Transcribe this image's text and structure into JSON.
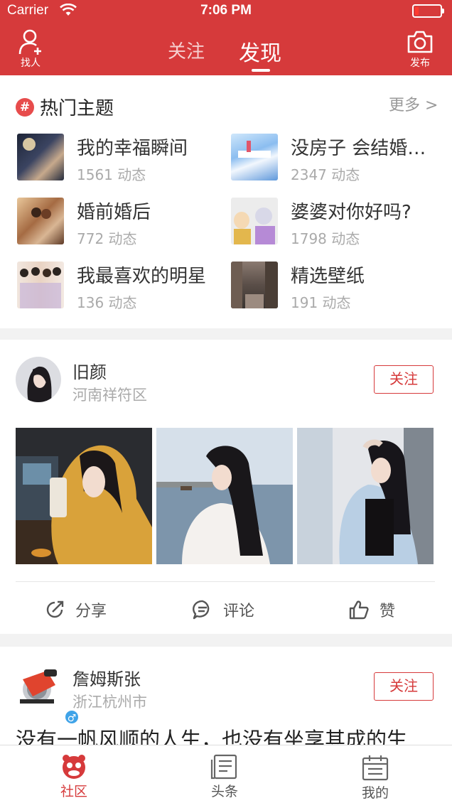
{
  "status_bar": {
    "carrier": "Carrier",
    "time": "7:06 PM"
  },
  "header": {
    "find_people": "找人",
    "publish": "发布",
    "tabs": [
      {
        "label": "关注",
        "active": false
      },
      {
        "label": "发现",
        "active": true
      }
    ]
  },
  "hot_topics": {
    "title": "热门主题",
    "more": "更多 >",
    "items": [
      {
        "name": "我的幸福瞬间",
        "count": "1561 动态"
      },
      {
        "name": "没房子 会结婚吗？",
        "count": "2347 动态"
      },
      {
        "name": "婚前婚后",
        "count": "772 动态"
      },
      {
        "name": "婆婆对你好吗?",
        "count": "1798 动态"
      },
      {
        "name": "我最喜欢的明星",
        "count": "136 动态"
      },
      {
        "name": "精选壁纸",
        "count": "191 动态"
      }
    ]
  },
  "posts": [
    {
      "username": "旧颜",
      "location": "河南祥符区",
      "follow": "关注",
      "actions": {
        "share": "分享",
        "comment": "评论",
        "like": "赞"
      }
    },
    {
      "username": "詹姆斯张",
      "location": "浙江杭州市",
      "follow": "关注",
      "gender": "♂",
      "text": "没有一帆风顺的人生，也没有坐享其成的生"
    }
  ],
  "tabbar": [
    {
      "label": "社区",
      "active": true
    },
    {
      "label": "头条",
      "active": false
    },
    {
      "label": "我的",
      "active": false
    }
  ],
  "colors": {
    "brand": "#d63a3b",
    "muted": "#aaaaaa",
    "background": "#f2f2f2"
  }
}
